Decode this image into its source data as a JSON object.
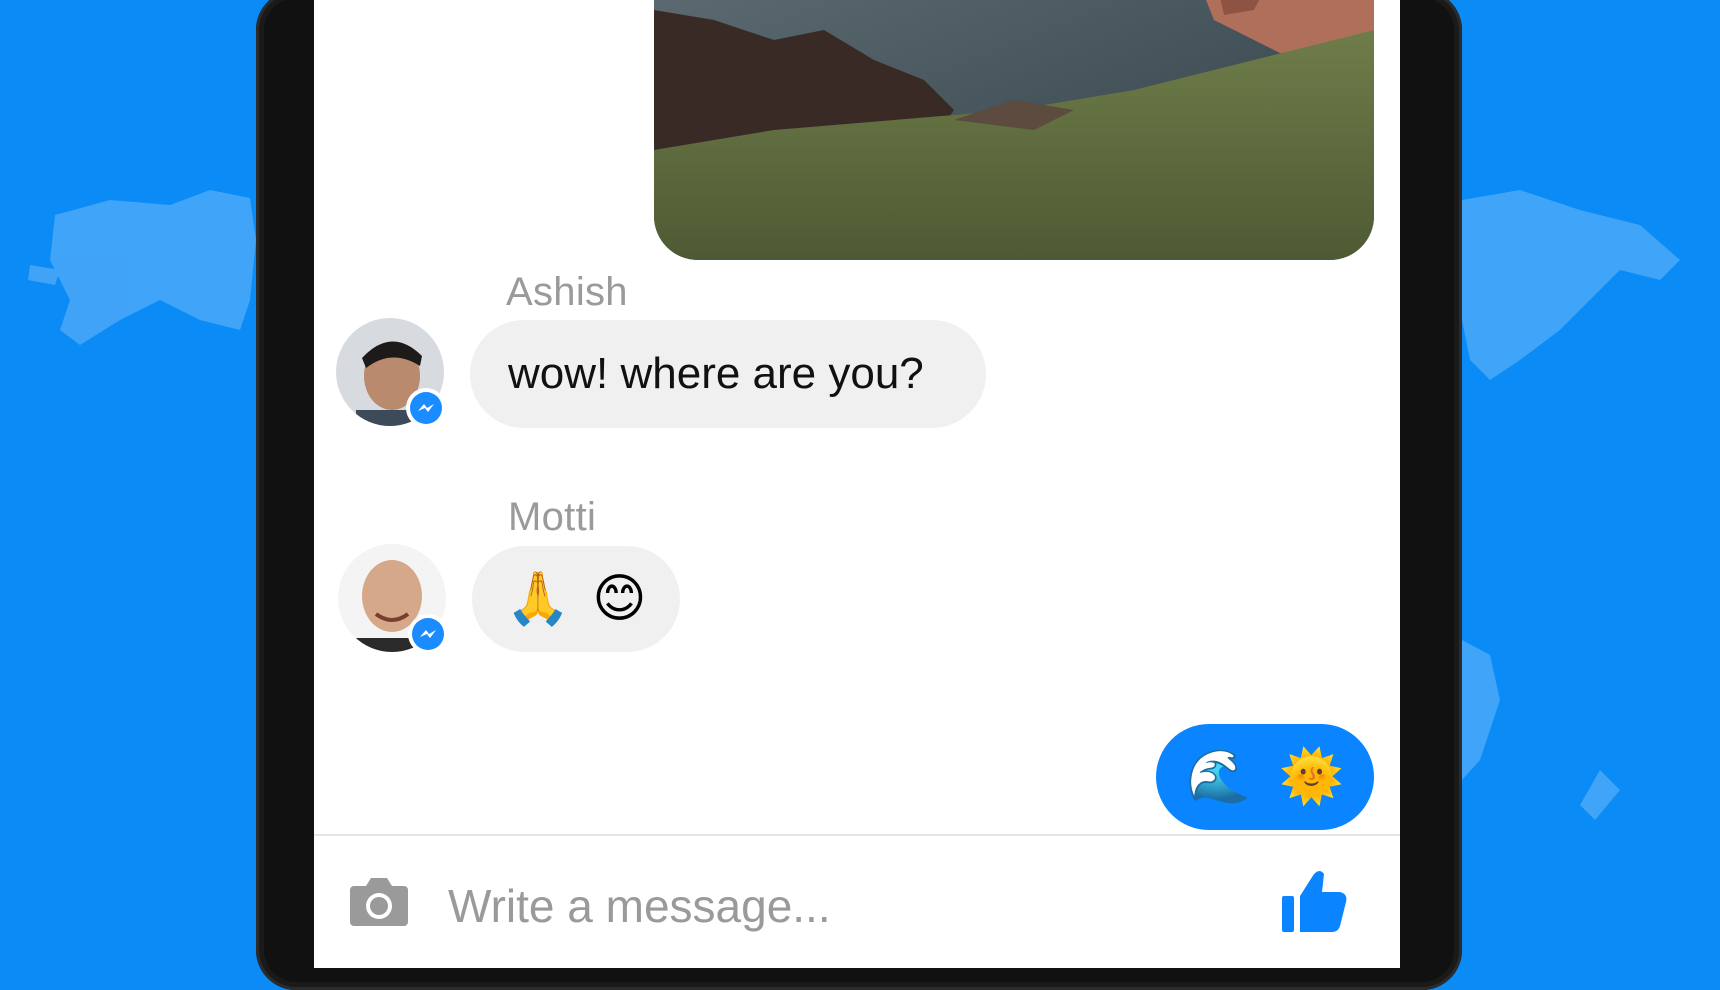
{
  "colors": {
    "background": "#0a8bf5",
    "outgoing_bubble": "#0a84ff",
    "incoming_bubble": "#f0f0f0",
    "sender_name": "#9a9a9a",
    "icon_gray": "#9a9a9a",
    "like_blue": "#0a84ff"
  },
  "conversation": {
    "messages": [
      {
        "sender": "Ashish",
        "text": "wow! where are you?"
      },
      {
        "sender": "Motti",
        "emojis": [
          "🙏",
          "😊"
        ]
      },
      {
        "direction": "outgoing",
        "emojis": [
          "🌊",
          "🌞"
        ]
      }
    ]
  },
  "composer": {
    "placeholder": "Write a message...",
    "camera_icon": "camera-icon",
    "like_icon": "thumbs-up-icon"
  }
}
